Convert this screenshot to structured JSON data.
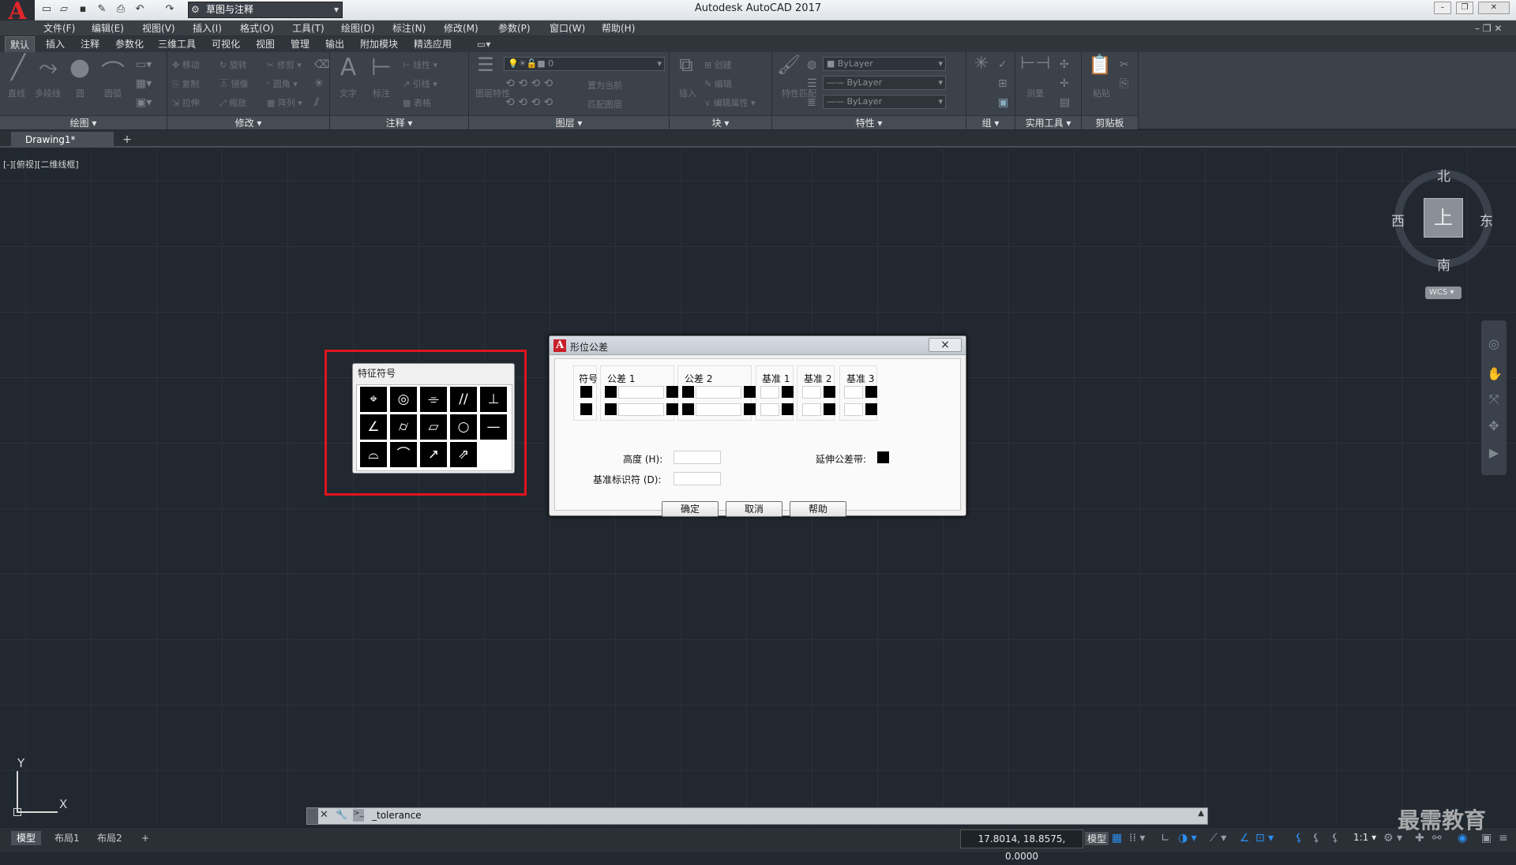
{
  "titlebar": {
    "app_title": "Autodesk AutoCAD 2017",
    "workspace": "草图与注释"
  },
  "menu": [
    "文件(F)",
    "编辑(E)",
    "视图(V)",
    "插入(I)",
    "格式(O)",
    "工具(T)",
    "绘图(D)",
    "标注(N)",
    "修改(M)",
    "参数(P)",
    "窗口(W)",
    "帮助(H)"
  ],
  "ribbon_tabs": [
    "默认",
    "插入",
    "注释",
    "参数化",
    "三维工具",
    "可视化",
    "视图",
    "管理",
    "输出",
    "附加模块",
    "精选应用"
  ],
  "panels": {
    "draw": "绘图",
    "modify": "修改",
    "annotation": "注释",
    "layers": "图层",
    "block": "块",
    "properties": "特性",
    "groups": "组",
    "utilities": "实用工具",
    "clipboard": "剪贴板"
  },
  "draw_tools": [
    "直线",
    "多段线",
    "圆",
    "圆弧"
  ],
  "modify_tools": [
    "移动",
    "旋转",
    "修剪",
    "复制",
    "镜像",
    "圆角",
    "拉伸",
    "缩放",
    "阵列"
  ],
  "annotation_tools": {
    "text": "文字",
    "dim": "标注",
    "linear": "线性",
    "leader": "引线",
    "table": "表格"
  },
  "layer_tools": {
    "props": "图层特性",
    "current_layer": "0",
    "make_current": "置为当前",
    "match": "匹配图层"
  },
  "block_tools": {
    "insert": "插入",
    "create": "创建",
    "edit": "编辑",
    "edit_attr": "编辑属性"
  },
  "prop_tools": {
    "match": "特性匹配",
    "color": "ByLayer",
    "linetype": "ByLayer",
    "lineweight": "ByLayer"
  },
  "util_tools": {
    "measure": "测量"
  },
  "clip_tools": {
    "paste": "粘贴"
  },
  "doc_tab": "Drawing1*",
  "viewport_label": "[-][俯视][二维线框]",
  "viewcube": {
    "north": "北",
    "south": "南",
    "east": "东",
    "west": "西",
    "top": "上",
    "wcs": "WCS"
  },
  "ucs": {
    "x": "X",
    "y": "Y"
  },
  "symbol_dialog": {
    "title": "特征符号",
    "symbols": [
      "⌖",
      "◎",
      "⌯",
      "//",
      "⊥",
      "∠",
      "⌭",
      "▱",
      "○",
      "—",
      "⌓",
      "⌒",
      "↗",
      "⇗",
      ""
    ]
  },
  "tolerance_dialog": {
    "title": "形位公差",
    "close": "×",
    "headers": {
      "sym": "符号",
      "tol1": "公差 1",
      "tol2": "公差 2",
      "datum1": "基准 1",
      "datum2": "基准 2",
      "datum3": "基准 3"
    },
    "height_label": "高度 (H):",
    "datum_id_label": "基准标识符 (D):",
    "projected_label": "延伸公差带:",
    "ok": "确定",
    "cancel": "取消",
    "help": "帮助"
  },
  "command": {
    "text": "_tolerance"
  },
  "layout_tabs": [
    "模型",
    "布局1",
    "布局2"
  ],
  "status": {
    "coords": "17.8014, 18.8575, 0.0000",
    "model": "模型",
    "scale": "1:1"
  },
  "watermark": "最需教育",
  "colors": {
    "canvas": "#212830",
    "accent": "#e0141c",
    "ribbon": "#3c424a"
  }
}
